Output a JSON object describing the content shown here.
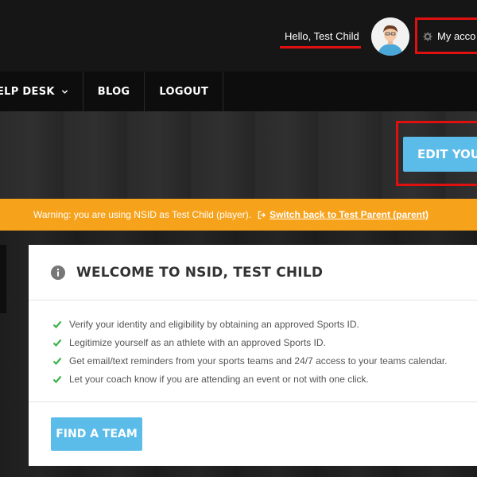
{
  "header": {
    "greeting": "Hello, Test Child",
    "account_label": "My acco",
    "accent_red": "#e01010"
  },
  "nav": {
    "items": [
      {
        "label": "ELP DESK",
        "has_dropdown": true
      },
      {
        "label": "BLOG",
        "has_dropdown": false
      },
      {
        "label": "LOGOUT",
        "has_dropdown": false
      }
    ]
  },
  "hero": {
    "edit_button_label": "EDIT YOUR P"
  },
  "warning": {
    "text": "Warning: you are using NSID as Test Child (player).",
    "link_label": "Switch back to Test Parent (parent)",
    "color": "#f7a21b"
  },
  "welcome": {
    "title": "WELCOME TO NSID, TEST CHILD",
    "items": [
      "Verify your identity and eligibility by obtaining an approved Sports ID.",
      "Legitimize yourself as an athlete with an approved Sports ID.",
      "Get email/text reminders from your sports teams and 24/7 access to your teams calendar.",
      "Let your coach know if you are attending an event or not with one click."
    ],
    "find_team_label": "FIND A TEAM",
    "button_color": "#5bbcea",
    "check_color": "#3cb34a"
  }
}
